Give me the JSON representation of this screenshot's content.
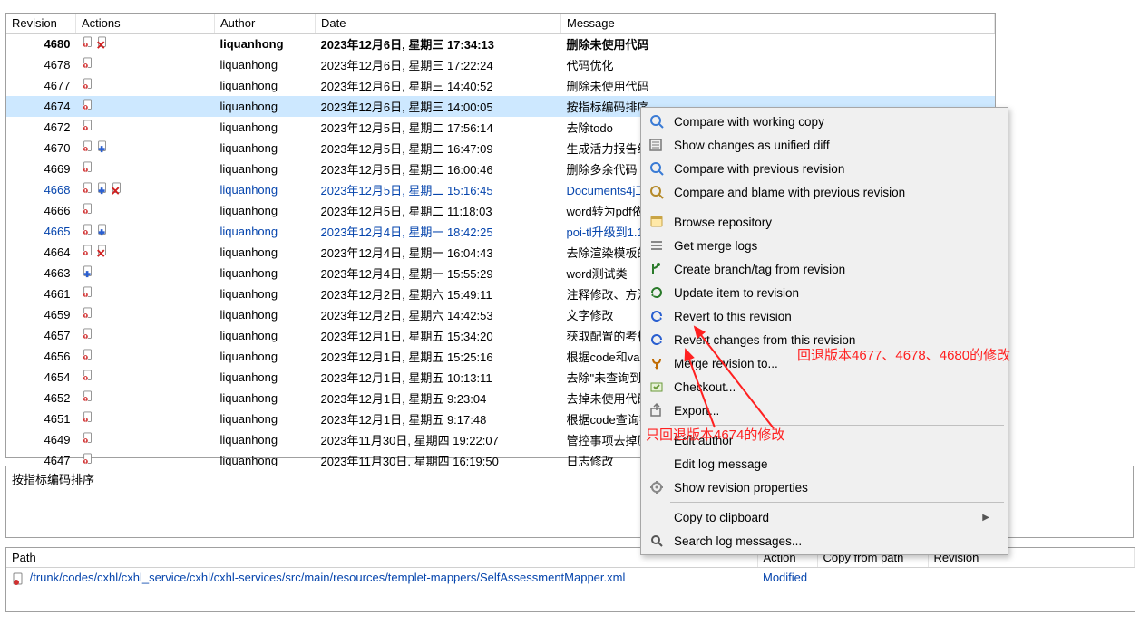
{
  "headers": {
    "revision": "Revision",
    "actions": "Actions",
    "author": "Author",
    "date": "Date",
    "message": "Message"
  },
  "rows": [
    {
      "rev": "4680",
      "auth": "liquanhong",
      "date": "2023年12月6日, 星期三 17:34:13",
      "msg": "删除未使用代码",
      "bold": true,
      "link": false,
      "icons": [
        "mod",
        "del"
      ]
    },
    {
      "rev": "4678",
      "auth": "liquanhong",
      "date": "2023年12月6日, 星期三 17:22:24",
      "msg": "代码优化",
      "bold": false,
      "link": false,
      "icons": [
        "mod"
      ]
    },
    {
      "rev": "4677",
      "auth": "liquanhong",
      "date": "2023年12月6日, 星期三 14:40:52",
      "msg": "删除未使用代码",
      "bold": false,
      "link": false,
      "icons": [
        "mod"
      ]
    },
    {
      "rev": "4674",
      "auth": "liquanhong",
      "date": "2023年12月6日, 星期三 14:00:05",
      "msg": "按指标编码排序",
      "bold": false,
      "link": false,
      "sel": true,
      "icons": [
        "mod"
      ]
    },
    {
      "rev": "4672",
      "auth": "liquanhong",
      "date": "2023年12月5日, 星期二 17:56:14",
      "msg": "去除todo",
      "bold": false,
      "link": false,
      "icons": [
        "mod"
      ]
    },
    {
      "rev": "4670",
      "auth": "liquanhong",
      "date": "2023年12月5日, 星期二 16:47:09",
      "msg": "生成活力报告线程",
      "bold": false,
      "link": false,
      "icons": [
        "mod",
        "add"
      ]
    },
    {
      "rev": "4669",
      "auth": "liquanhong",
      "date": "2023年12月5日, 星期二 16:00:46",
      "msg": "删除多余代码",
      "bold": false,
      "link": false,
      "icons": [
        "mod"
      ]
    },
    {
      "rev": "4668",
      "auth": "liquanhong",
      "date": "2023年12月5日, 星期二 15:16:45",
      "msg": "Documents4j工具",
      "bold": false,
      "link": true,
      "icons": [
        "mod",
        "add",
        "del"
      ]
    },
    {
      "rev": "4666",
      "auth": "liquanhong",
      "date": "2023年12月5日, 星期二 11:18:03",
      "msg": "word转为pdf依赖",
      "bold": false,
      "link": false,
      "icons": [
        "mod"
      ]
    },
    {
      "rev": "4665",
      "auth": "liquanhong",
      "date": "2023年12月4日, 星期一 18:42:25",
      "msg": "poi-tl升级到1.10.5",
      "bold": false,
      "link": true,
      "icons": [
        "mod",
        "add"
      ]
    },
    {
      "rev": "4664",
      "auth": "liquanhong",
      "date": "2023年12月4日, 星期一 16:04:43",
      "msg": "去除渲染模板的多",
      "bold": false,
      "link": false,
      "icons": [
        "mod",
        "del"
      ]
    },
    {
      "rev": "4663",
      "auth": "liquanhong",
      "date": "2023年12月4日, 星期一 15:55:29",
      "msg": "word测试类",
      "bold": false,
      "link": false,
      "icons": [
        "add"
      ]
    },
    {
      "rev": "4661",
      "auth": "liquanhong",
      "date": "2023年12月2日, 星期六 15:49:11",
      "msg": "注释修改、方法重",
      "bold": false,
      "link": false,
      "icons": [
        "mod"
      ]
    },
    {
      "rev": "4659",
      "auth": "liquanhong",
      "date": "2023年12月2日, 星期六 14:42:53",
      "msg": "文字修改",
      "bold": false,
      "link": false,
      "icons": [
        "mod"
      ]
    },
    {
      "rev": "4657",
      "auth": "liquanhong",
      "date": "2023年12月1日, 星期五 15:34:20",
      "msg": "获取配置的考核年",
      "bold": false,
      "link": false,
      "icons": [
        "mod"
      ]
    },
    {
      "rev": "4656",
      "auth": "liquanhong",
      "date": "2023年12月1日, 星期五 15:25:16",
      "msg": "根据code和value查",
      "bold": false,
      "link": false,
      "icons": [
        "mod"
      ]
    },
    {
      "rev": "4654",
      "auth": "liquanhong",
      "date": "2023年12月1日, 星期五 10:13:11",
      "msg": "去除\"未查询到自评",
      "bold": false,
      "link": false,
      "icons": [
        "mod"
      ]
    },
    {
      "rev": "4652",
      "auth": "liquanhong",
      "date": "2023年12月1日, 星期五 9:23:04",
      "msg": "去掉未使用代码",
      "bold": false,
      "link": false,
      "icons": [
        "mod"
      ]
    },
    {
      "rev": "4651",
      "auth": "liquanhong",
      "date": "2023年12月1日, 星期五 9:17:48",
      "msg": "根据code查询字典",
      "bold": false,
      "link": false,
      "icons": [
        "mod"
      ]
    },
    {
      "rev": "4649",
      "auth": "liquanhong",
      "date": "2023年11月30日, 星期四 19:22:07",
      "msg": "管控事项去掉原始",
      "bold": false,
      "link": false,
      "icons": [
        "mod"
      ]
    },
    {
      "rev": "4647",
      "auth": "liquanhong",
      "date": "2023年11月30日, 星期四 16:19:50",
      "msg": "日志修改",
      "bold": false,
      "link": false,
      "icons": [
        "mod"
      ]
    }
  ],
  "commit_message_panel": "按指标编码排序",
  "bottom_headers": {
    "path": "Path",
    "action": "Action",
    "copy_from": "Copy from path",
    "revision": "Revision"
  },
  "bottom_row": {
    "path": "/trunk/codes/cxhl/cxhl_service/cxhl/cxhl-services/src/main/resources/templet-mappers/SelfAssessmentMapper.xml",
    "action": "Modified",
    "copy_from": "",
    "revision": ""
  },
  "menu": {
    "items": [
      {
        "label": "Compare with working copy",
        "icon": "compare"
      },
      {
        "label": "Show changes as unified diff",
        "icon": "diff"
      },
      {
        "label": "Compare with previous revision",
        "icon": "compare"
      },
      {
        "label": "Compare and blame with previous revision",
        "icon": "blame"
      },
      {
        "sep": true
      },
      {
        "label": "Browse repository",
        "icon": "browse"
      },
      {
        "label": "Get merge logs",
        "icon": "lines"
      },
      {
        "label": "Create branch/tag from revision",
        "icon": "branch"
      },
      {
        "label": "Update item to revision",
        "icon": "update"
      },
      {
        "label": "Revert to this revision",
        "icon": "revert"
      },
      {
        "label": "Revert changes from this revision",
        "icon": "revert"
      },
      {
        "label": "Merge revision to...",
        "icon": "merge"
      },
      {
        "label": "Checkout...",
        "icon": "checkout"
      },
      {
        "label": "Export...",
        "icon": "export"
      },
      {
        "sep": true
      },
      {
        "label": "Edit author",
        "icon": ""
      },
      {
        "label": "Edit log message",
        "icon": ""
      },
      {
        "label": "Show revision properties",
        "icon": "props"
      },
      {
        "sep": true
      },
      {
        "label": "Copy to clipboard",
        "icon": "",
        "sub": true
      },
      {
        "label": "Search log messages...",
        "icon": "search"
      }
    ]
  },
  "annotations": {
    "a1": "回退版本4677、4678、4680的修改",
    "a2": "只回退版本4674的修改"
  }
}
